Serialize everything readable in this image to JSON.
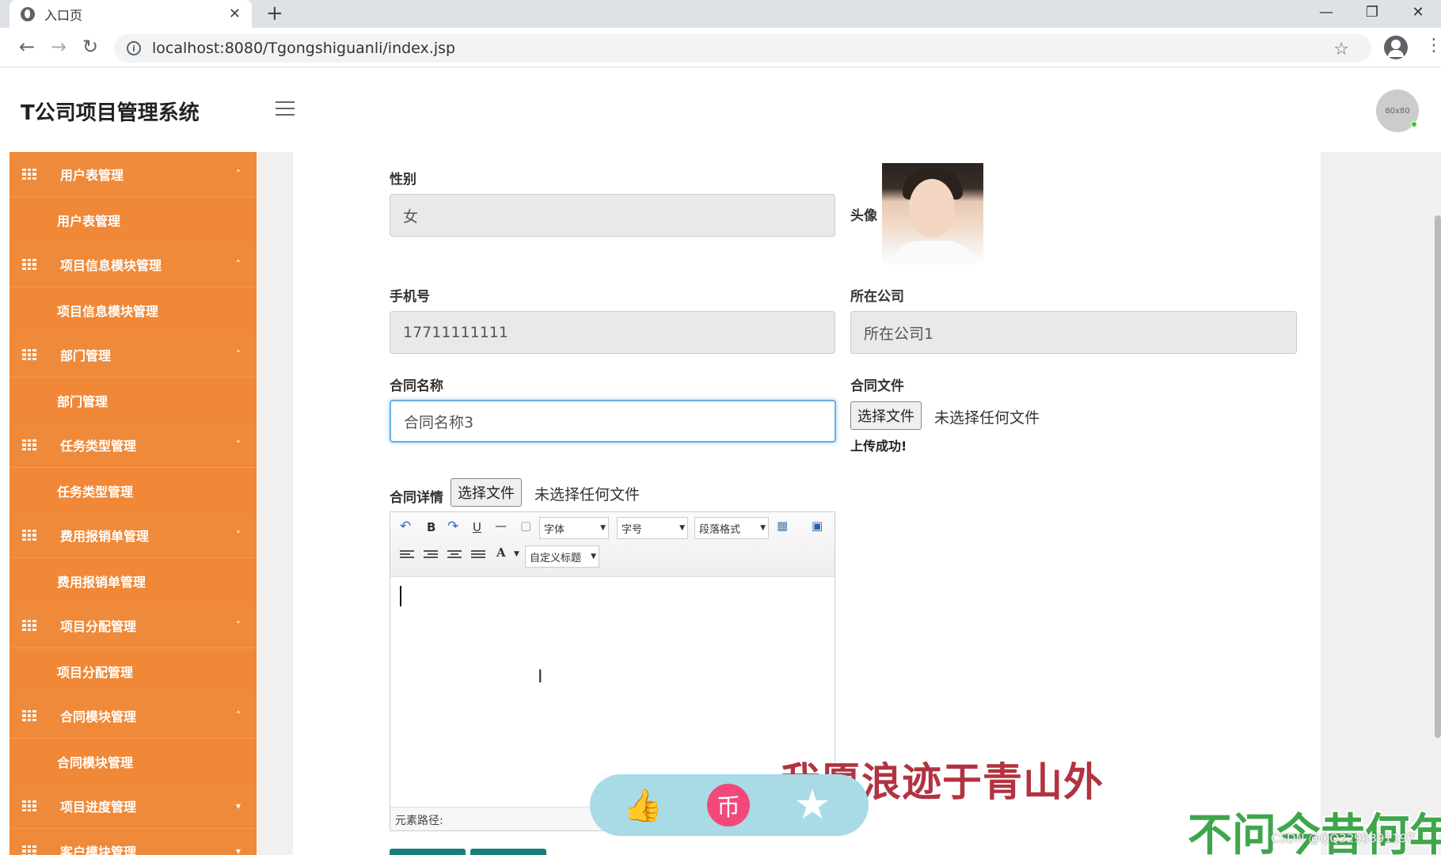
{
  "browser": {
    "tab_title": "入口页",
    "tab_close": "✕",
    "new_tab": "+",
    "url": "localhost:8080/Tgongshiguanli/index.jsp"
  },
  "app": {
    "title": "T公司项目管理系统",
    "avatar_text": "80x80"
  },
  "sidebar": {
    "items": [
      {
        "type": "parent",
        "label": "用户表管理"
      },
      {
        "type": "child",
        "label": "用户表管理"
      },
      {
        "type": "parent",
        "label": "项目信息模块管理"
      },
      {
        "type": "child",
        "label": "项目信息模块管理"
      },
      {
        "type": "parent",
        "label": "部门管理"
      },
      {
        "type": "child",
        "label": "部门管理"
      },
      {
        "type": "parent",
        "label": "任务类型管理"
      },
      {
        "type": "child",
        "label": "任务类型管理"
      },
      {
        "type": "parent",
        "label": "费用报销单管理"
      },
      {
        "type": "child",
        "label": "费用报销单管理"
      },
      {
        "type": "parent",
        "label": "项目分配管理"
      },
      {
        "type": "child",
        "label": "项目分配管理"
      },
      {
        "type": "parent",
        "label": "合同模块管理"
      },
      {
        "type": "child",
        "label": "合同模块管理"
      },
      {
        "type": "parent",
        "label": "项目进度管理"
      },
      {
        "type": "parent",
        "label": "客户模块管理"
      }
    ]
  },
  "form": {
    "gender_label": "性别",
    "gender_value": "女",
    "avatar_label": "头像",
    "phone_label": "手机号",
    "phone_value": "17711111111",
    "company_label": "所在公司",
    "company_value": "所在公司1",
    "contract_name_label": "合同名称",
    "contract_name_value": "合同名称3",
    "contract_file_label": "合同文件",
    "choose_file": "选择文件",
    "no_file": "未选择任何文件",
    "upload_success": "上传成功!",
    "contract_detail_label": "合同详情"
  },
  "editor": {
    "bold": "B",
    "underline": "U",
    "hr": "—",
    "font_select": "字体",
    "size_select": "字号",
    "paragraph_select": "段落格式",
    "font_color": "A",
    "custom_title_select": "自定义标题",
    "path_label": "元素路径:"
  },
  "overlay": {
    "lyric_1": "我愿浪迹于青山外",
    "lyric_2": "不问今昔何年",
    "watermark": "CSDN @QQ3295391197"
  }
}
